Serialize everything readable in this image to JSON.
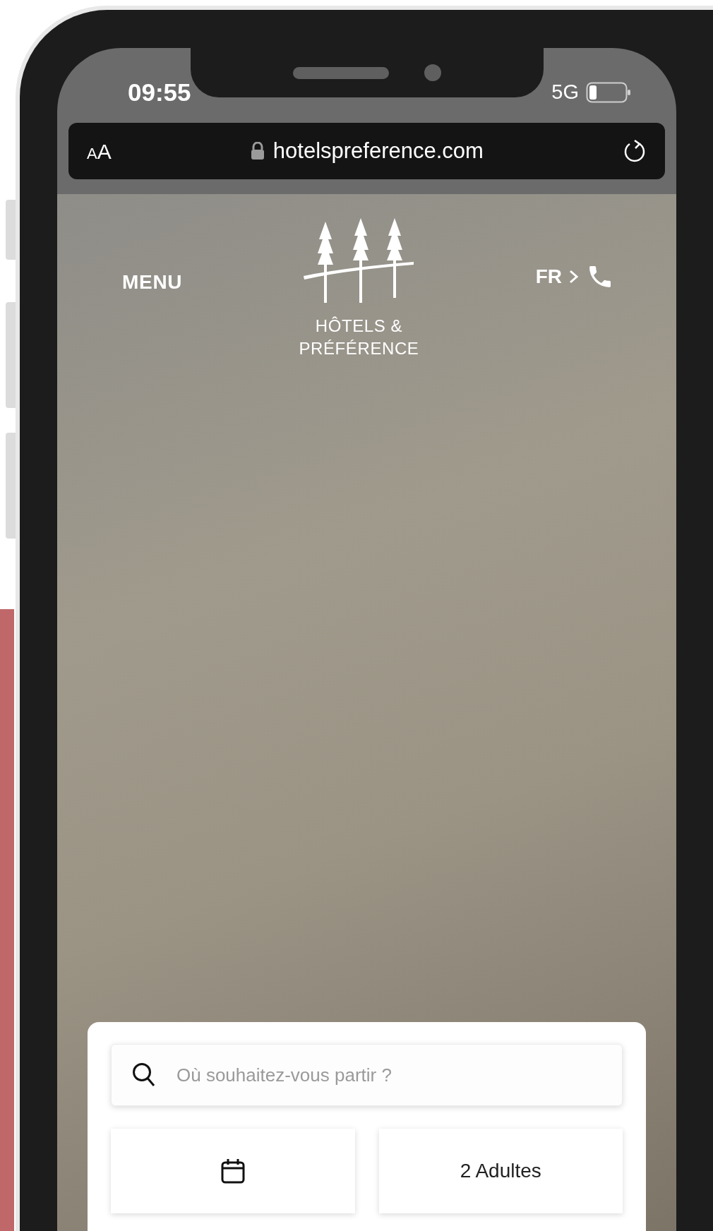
{
  "status_bar": {
    "time": "09:55",
    "network": "5G"
  },
  "browser": {
    "text_size_button": "AA",
    "url": "hotelspreference.com"
  },
  "header": {
    "menu": "MENU",
    "language": "FR",
    "logo_lines": [
      "HÔTELS &",
      "PRÉFÉRENCE"
    ]
  },
  "search_card": {
    "destination": {
      "placeholder": "Où souhaitez-vous partir ?"
    },
    "guests": "2 Adultes"
  }
}
